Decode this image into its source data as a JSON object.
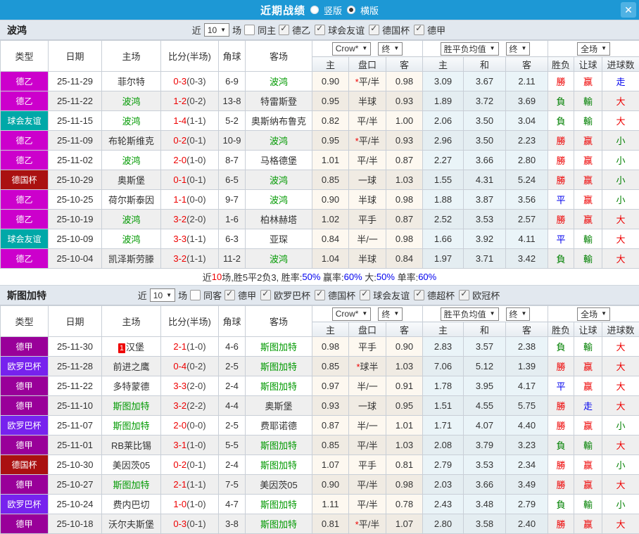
{
  "window": {
    "title": "近期战绩",
    "radios": [
      {
        "label": "竖版",
        "selected": false
      },
      {
        "label": "横版",
        "selected": true
      }
    ],
    "close_label": "✕"
  },
  "filters_common": {
    "near": "近",
    "count": "10",
    "matches": "场"
  },
  "table": {
    "main_headers": [
      "类型",
      "日期",
      "主场",
      "比分(半场)",
      "角球",
      "客场"
    ],
    "sub_headers": [
      "主",
      "盘口",
      "客",
      "主",
      "和",
      "客",
      "胜负",
      "让球",
      "进球数"
    ],
    "dropdowns": {
      "odds_source": "Crow*",
      "odds_final": "终",
      "mean": "胜平负均值",
      "mean_final": "终",
      "scope": "全场"
    }
  },
  "type_colors": {
    "德乙": "#cc00cc",
    "球会友谊": "#00a8a8",
    "德国杯": "#aa1111",
    "德甲": "#990099",
    "欧罗巴杯": "#7722ee"
  },
  "result_colors": {
    "勝": "#ee0000",
    "負": "#008000",
    "平": "#0000ee",
    "赢": "#ee0000",
    "輸": "#008000",
    "走": "#0000ee",
    "大": "#ee0000",
    "小": "#008000"
  },
  "sections": [
    {
      "team": "波鸿",
      "same_side_label": "同主",
      "same_side_checked": false,
      "leagues": [
        {
          "label": "德乙",
          "checked": true
        },
        {
          "label": "球会友谊",
          "checked": true
        },
        {
          "label": "德国杯",
          "checked": true
        },
        {
          "label": "德甲",
          "checked": true
        }
      ],
      "rows": [
        {
          "type": "德乙",
          "date": "25-11-29",
          "home": "菲尔特",
          "home_badge": "",
          "score": "0-3",
          "half": "(0-3)",
          "corners": "6-9",
          "away": "波鸿",
          "odds_home": "0.90",
          "handicap_star": true,
          "handicap": "平/半",
          "odds_away": "0.98",
          "avg_home": "3.09",
          "avg_draw": "3.67",
          "avg_away": "2.11",
          "res_outcome": "勝",
          "res_handicap": "赢",
          "res_goals": "走"
        },
        {
          "type": "德乙",
          "date": "25-11-22",
          "home": "波鸿",
          "home_badge": "",
          "score": "1-2",
          "half": "(0-2)",
          "corners": "13-8",
          "away": "特雷斯登",
          "odds_home": "0.95",
          "handicap_star": false,
          "handicap": "半球",
          "odds_away": "0.93",
          "avg_home": "1.89",
          "avg_draw": "3.72",
          "avg_away": "3.69",
          "res_outcome": "負",
          "res_handicap": "輸",
          "res_goals": "大"
        },
        {
          "type": "球会友谊",
          "date": "25-11-15",
          "home": "波鸿",
          "home_badge": "",
          "score": "1-4",
          "half": "(1-1)",
          "corners": "5-2",
          "away": "奥斯纳布鲁克",
          "odds_home": "0.82",
          "handicap_star": false,
          "handicap": "平/半",
          "odds_away": "1.00",
          "avg_home": "2.06",
          "avg_draw": "3.50",
          "avg_away": "3.04",
          "res_outcome": "負",
          "res_handicap": "輸",
          "res_goals": "大"
        },
        {
          "type": "德乙",
          "date": "25-11-09",
          "home": "布轮斯维克",
          "home_badge": "",
          "score": "0-2",
          "half": "(0-1)",
          "corners": "10-9",
          "away": "波鸿",
          "odds_home": "0.95",
          "handicap_star": true,
          "handicap": "平/半",
          "odds_away": "0.93",
          "avg_home": "2.96",
          "avg_draw": "3.50",
          "avg_away": "2.23",
          "res_outcome": "勝",
          "res_handicap": "赢",
          "res_goals": "小"
        },
        {
          "type": "德乙",
          "date": "25-11-02",
          "home": "波鸿",
          "home_badge": "",
          "score": "2-0",
          "half": "(1-0)",
          "corners": "8-7",
          "away": "马格德堡",
          "odds_home": "1.01",
          "handicap_star": false,
          "handicap": "平/半",
          "odds_away": "0.87",
          "avg_home": "2.27",
          "avg_draw": "3.66",
          "avg_away": "2.80",
          "res_outcome": "勝",
          "res_handicap": "赢",
          "res_goals": "小"
        },
        {
          "type": "德国杯",
          "date": "25-10-29",
          "home": "奥斯堡",
          "home_badge": "",
          "score": "0-1",
          "half": "(0-1)",
          "corners": "6-5",
          "away": "波鸿",
          "odds_home": "0.85",
          "handicap_star": false,
          "handicap": "一球",
          "odds_away": "1.03",
          "avg_home": "1.55",
          "avg_draw": "4.31",
          "avg_away": "5.24",
          "res_outcome": "勝",
          "res_handicap": "赢",
          "res_goals": "小"
        },
        {
          "type": "德乙",
          "date": "25-10-25",
          "home": "荷尔斯泰因",
          "home_badge": "",
          "score": "1-1",
          "half": "(0-0)",
          "corners": "9-7",
          "away": "波鸿",
          "odds_home": "0.90",
          "handicap_star": false,
          "handicap": "半球",
          "odds_away": "0.98",
          "avg_home": "1.88",
          "avg_draw": "3.87",
          "avg_away": "3.56",
          "res_outcome": "平",
          "res_handicap": "赢",
          "res_goals": "小"
        },
        {
          "type": "德乙",
          "date": "25-10-19",
          "home": "波鸿",
          "home_badge": "",
          "score": "3-2",
          "half": "(2-0)",
          "corners": "1-6",
          "away": "柏林赫塔",
          "odds_home": "1.02",
          "handicap_star": false,
          "handicap": "平手",
          "odds_away": "0.87",
          "avg_home": "2.52",
          "avg_draw": "3.53",
          "avg_away": "2.57",
          "res_outcome": "勝",
          "res_handicap": "赢",
          "res_goals": "大"
        },
        {
          "type": "球会友谊",
          "date": "25-10-09",
          "home": "波鸿",
          "home_badge": "",
          "score": "3-3",
          "half": "(1-1)",
          "corners": "6-3",
          "away": "亚琛",
          "odds_home": "0.84",
          "handicap_star": false,
          "handicap": "半/一",
          "odds_away": "0.98",
          "avg_home": "1.66",
          "avg_draw": "3.92",
          "avg_away": "4.11",
          "res_outcome": "平",
          "res_handicap": "輸",
          "res_goals": "大"
        },
        {
          "type": "德乙",
          "date": "25-10-04",
          "home": "凯泽斯劳滕",
          "home_badge": "",
          "score": "3-2",
          "half": "(1-1)",
          "corners": "11-2",
          "away": "波鸿",
          "odds_home": "1.04",
          "handicap_star": false,
          "handicap": "半球",
          "odds_away": "0.84",
          "avg_home": "1.97",
          "avg_draw": "3.71",
          "avg_away": "3.42",
          "res_outcome": "負",
          "res_handicap": "輸",
          "res_goals": "大"
        }
      ],
      "summary": [
        {
          "text": "近",
          "color": "#333333"
        },
        {
          "text": "10",
          "color": "#ee0000"
        },
        {
          "text": "场,胜5平2负3, 胜率:",
          "color": "#333333"
        },
        {
          "text": "50%",
          "color": "#0000ee"
        },
        {
          "text": " 赢率:",
          "color": "#333333"
        },
        {
          "text": "60%",
          "color": "#0000ee"
        },
        {
          "text": " 大:",
          "color": "#333333"
        },
        {
          "text": "50%",
          "color": "#0000ee"
        },
        {
          "text": " 单率:",
          "color": "#333333"
        },
        {
          "text": "60%",
          "color": "#0000ee"
        }
      ]
    },
    {
      "team": "斯图加特",
      "same_side_label": "同客",
      "same_side_checked": false,
      "leagues": [
        {
          "label": "德甲",
          "checked": true
        },
        {
          "label": "欧罗巴杯",
          "checked": true
        },
        {
          "label": "德国杯",
          "checked": true
        },
        {
          "label": "球会友谊",
          "checked": true
        },
        {
          "label": "德超杯",
          "checked": true
        },
        {
          "label": "欧冠杯",
          "checked": true
        }
      ],
      "rows": [
        {
          "type": "德甲",
          "date": "25-11-30",
          "home": "汉堡",
          "home_badge": "1",
          "score": "2-1",
          "half": "(1-0)",
          "corners": "4-6",
          "away": "斯图加特",
          "odds_home": "0.98",
          "handicap_star": false,
          "handicap": "平手",
          "odds_away": "0.90",
          "avg_home": "2.83",
          "avg_draw": "3.57",
          "avg_away": "2.38",
          "res_outcome": "負",
          "res_handicap": "輸",
          "res_goals": "大"
        },
        {
          "type": "欧罗巴杯",
          "date": "25-11-28",
          "home": "前进之鹰",
          "home_badge": "",
          "score": "0-4",
          "half": "(0-2)",
          "corners": "2-5",
          "away": "斯图加特",
          "odds_home": "0.85",
          "handicap_star": true,
          "handicap": "球半",
          "odds_away": "1.03",
          "avg_home": "7.06",
          "avg_draw": "5.12",
          "avg_away": "1.39",
          "res_outcome": "勝",
          "res_handicap": "赢",
          "res_goals": "大"
        },
        {
          "type": "德甲",
          "date": "25-11-22",
          "home": "多特蒙德",
          "home_badge": "",
          "score": "3-3",
          "half": "(2-0)",
          "corners": "2-4",
          "away": "斯图加特",
          "odds_home": "0.97",
          "handicap_star": false,
          "handicap": "半/一",
          "odds_away": "0.91",
          "avg_home": "1.78",
          "avg_draw": "3.95",
          "avg_away": "4.17",
          "res_outcome": "平",
          "res_handicap": "赢",
          "res_goals": "大"
        },
        {
          "type": "德甲",
          "date": "25-11-10",
          "home": "斯图加特",
          "home_badge": "",
          "score": "3-2",
          "half": "(2-2)",
          "corners": "4-4",
          "away": "奥斯堡",
          "odds_home": "0.93",
          "handicap_star": false,
          "handicap": "一球",
          "odds_away": "0.95",
          "avg_home": "1.51",
          "avg_draw": "4.55",
          "avg_away": "5.75",
          "res_outcome": "勝",
          "res_handicap": "走",
          "res_goals": "大"
        },
        {
          "type": "欧罗巴杯",
          "date": "25-11-07",
          "home": "斯图加特",
          "home_badge": "",
          "score": "2-0",
          "half": "(0-0)",
          "corners": "2-5",
          "away": "费耶诺德",
          "odds_home": "0.87",
          "handicap_star": false,
          "handicap": "半/一",
          "odds_away": "1.01",
          "avg_home": "1.71",
          "avg_draw": "4.07",
          "avg_away": "4.40",
          "res_outcome": "勝",
          "res_handicap": "赢",
          "res_goals": "小"
        },
        {
          "type": "德甲",
          "date": "25-11-01",
          "home": "RB莱比锡",
          "home_badge": "",
          "score": "3-1",
          "half": "(1-0)",
          "corners": "5-5",
          "away": "斯图加特",
          "odds_home": "0.85",
          "handicap_star": false,
          "handicap": "平/半",
          "odds_away": "1.03",
          "avg_home": "2.08",
          "avg_draw": "3.79",
          "avg_away": "3.23",
          "res_outcome": "負",
          "res_handicap": "輸",
          "res_goals": "大"
        },
        {
          "type": "德国杯",
          "date": "25-10-30",
          "home": "美因茨05",
          "home_badge": "",
          "score": "0-2",
          "half": "(0-1)",
          "corners": "2-4",
          "away": "斯图加特",
          "odds_home": "1.07",
          "handicap_star": false,
          "handicap": "平手",
          "odds_away": "0.81",
          "avg_home": "2.79",
          "avg_draw": "3.53",
          "avg_away": "2.34",
          "res_outcome": "勝",
          "res_handicap": "赢",
          "res_goals": "小"
        },
        {
          "type": "德甲",
          "date": "25-10-27",
          "home": "斯图加特",
          "home_badge": "",
          "score": "2-1",
          "half": "(1-1)",
          "corners": "7-5",
          "away": "美因茨05",
          "odds_home": "0.90",
          "handicap_star": false,
          "handicap": "平/半",
          "odds_away": "0.98",
          "avg_home": "2.03",
          "avg_draw": "3.66",
          "avg_away": "3.49",
          "res_outcome": "勝",
          "res_handicap": "赢",
          "res_goals": "大"
        },
        {
          "type": "欧罗巴杯",
          "date": "25-10-24",
          "home": "费内巴切",
          "home_badge": "",
          "score": "1-0",
          "half": "(1-0)",
          "corners": "4-7",
          "away": "斯图加特",
          "odds_home": "1.11",
          "handicap_star": false,
          "handicap": "平/半",
          "odds_away": "0.78",
          "avg_home": "2.43",
          "avg_draw": "3.48",
          "avg_away": "2.79",
          "res_outcome": "負",
          "res_handicap": "輸",
          "res_goals": "小"
        },
        {
          "type": "德甲",
          "date": "25-10-18",
          "home": "沃尔夫斯堡",
          "home_badge": "",
          "score": "0-3",
          "half": "(0-1)",
          "corners": "3-8",
          "away": "斯图加特",
          "odds_home": "0.81",
          "handicap_star": true,
          "handicap": "平/半",
          "odds_away": "1.07",
          "avg_home": "2.80",
          "avg_draw": "3.58",
          "avg_away": "2.40",
          "res_outcome": "勝",
          "res_handicap": "赢",
          "res_goals": "大"
        }
      ],
      "summary": null
    }
  ]
}
